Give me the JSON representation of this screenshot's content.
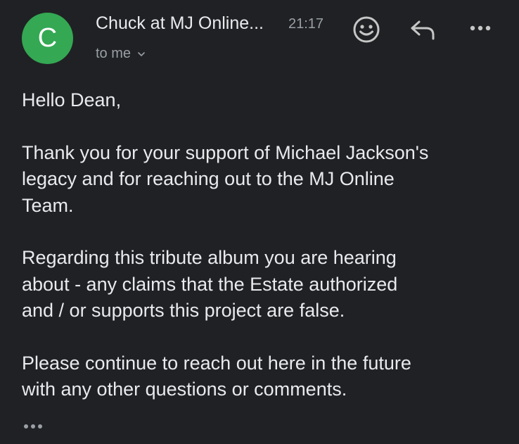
{
  "email": {
    "avatar_initial": "C",
    "sender": "Chuck at MJ Online...",
    "time": "21:17",
    "recipient": "to me",
    "body": {
      "greeting": "Hello Dean,",
      "para1_line1": "Thank you for your support of Michael Jackson's",
      "para1_line2": "legacy and for reaching out to the MJ Online",
      "para1_line3": "Team.",
      "para2_line1": "Regarding this tribute album you are hearing",
      "para2_line2": "about - any claims that the Estate authorized",
      "para2_line3": "and / or supports this project are false.",
      "para3_line1": "Please continue to reach out here in the future",
      "para3_line2": "with any other questions or comments."
    }
  },
  "colors": {
    "background": "#202124",
    "avatar": "#34a853",
    "primary_text": "#e8eaed",
    "secondary_text": "#9aa0a6"
  },
  "icons": {
    "reaction": "emoji-smile-icon",
    "reply": "reply-arrow-icon",
    "more": "more-horizontal-icon",
    "expand": "chevron-down-icon",
    "trimmed": "show-trimmed-content-icon"
  }
}
